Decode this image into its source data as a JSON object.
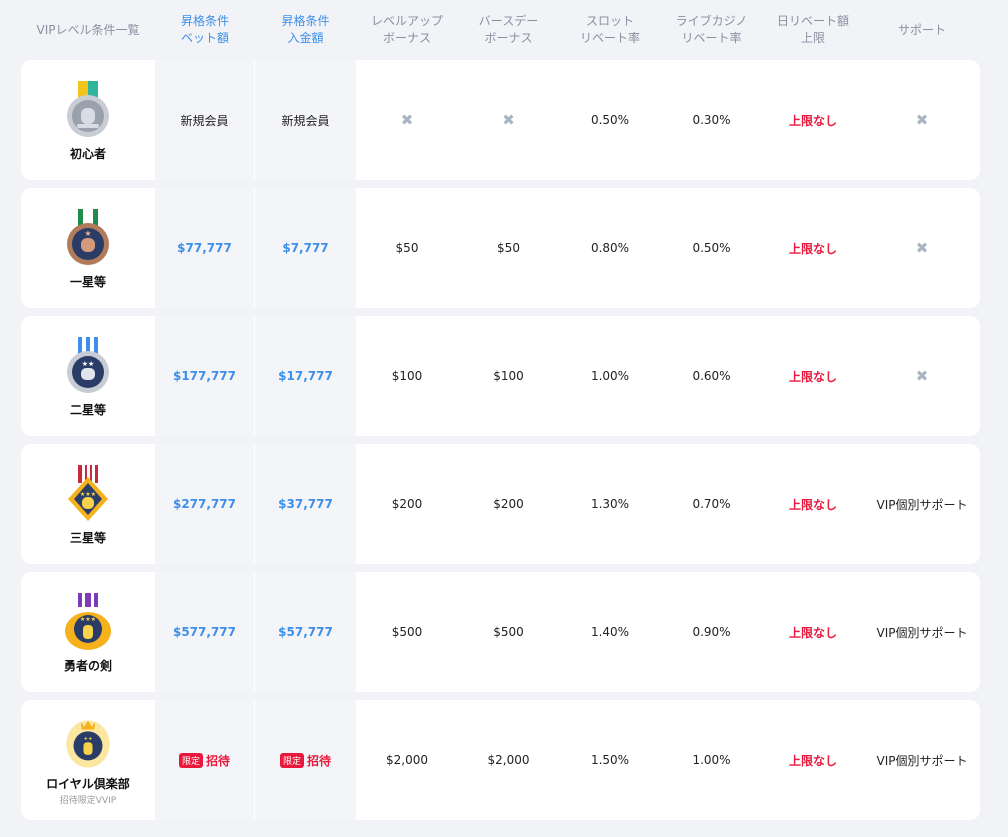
{
  "header": {
    "level": "VIPレベル条件一覧",
    "bet": "昇格条件\nベット額",
    "deposit": "昇格条件\n入金額",
    "levelup": "レベルアップ\nボーナス",
    "birthday": "バースデー\nボーナス",
    "slot": "スロット\nリベート率",
    "live": "ライブカジノ\nリベート率",
    "daily": "日リベート額\n上限",
    "support": "サポート"
  },
  "rows": [
    {
      "name": "初心者",
      "sub": "",
      "bet": "新規会員",
      "deposit": "新規会員",
      "levelup": "✖",
      "birthday": "✖",
      "slot": "0.50%",
      "live": "0.30%",
      "daily": "上限なし",
      "support": "✖"
    },
    {
      "name": "一星等",
      "sub": "",
      "bet": "$77,777",
      "deposit": "$7,777",
      "levelup": "$50",
      "birthday": "$50",
      "slot": "0.80%",
      "live": "0.50%",
      "daily": "上限なし",
      "support": "✖"
    },
    {
      "name": "二星等",
      "sub": "",
      "bet": "$177,777",
      "deposit": "$17,777",
      "levelup": "$100",
      "birthday": "$100",
      "slot": "1.00%",
      "live": "0.60%",
      "daily": "上限なし",
      "support": "✖"
    },
    {
      "name": "三星等",
      "sub": "",
      "bet": "$277,777",
      "deposit": "$37,777",
      "levelup": "$200",
      "birthday": "$200",
      "slot": "1.30%",
      "live": "0.70%",
      "daily": "上限なし",
      "support": "VIP個別サポート"
    },
    {
      "name": "勇者の剣",
      "sub": "",
      "bet": "$577,777",
      "deposit": "$57,777",
      "levelup": "$500",
      "birthday": "$500",
      "slot": "1.40%",
      "live": "0.90%",
      "daily": "上限なし",
      "support": "VIP個別サポート"
    },
    {
      "name": "ロイヤル倶楽部",
      "sub": "招待限定VVIP",
      "bet_badge": "限定",
      "bet_text": "招待",
      "deposit_badge": "限定",
      "deposit_text": "招待",
      "levelup": "$2,000",
      "birthday": "$2,000",
      "slot": "1.50%",
      "live": "1.00%",
      "daily": "上限なし",
      "support": "VIP個別サポート"
    }
  ],
  "colors": {
    "accent": "#3d8fe8",
    "red": "#e8193c",
    "bg": "#f2f3f7",
    "muted": "#aab4c4"
  },
  "icons": [
    "medal-beginner-icon",
    "medal-one-star-icon",
    "medal-two-star-icon",
    "medal-three-star-icon",
    "medal-hero-sword-icon",
    "medal-royal-crown-icon",
    "cross-icon"
  ]
}
